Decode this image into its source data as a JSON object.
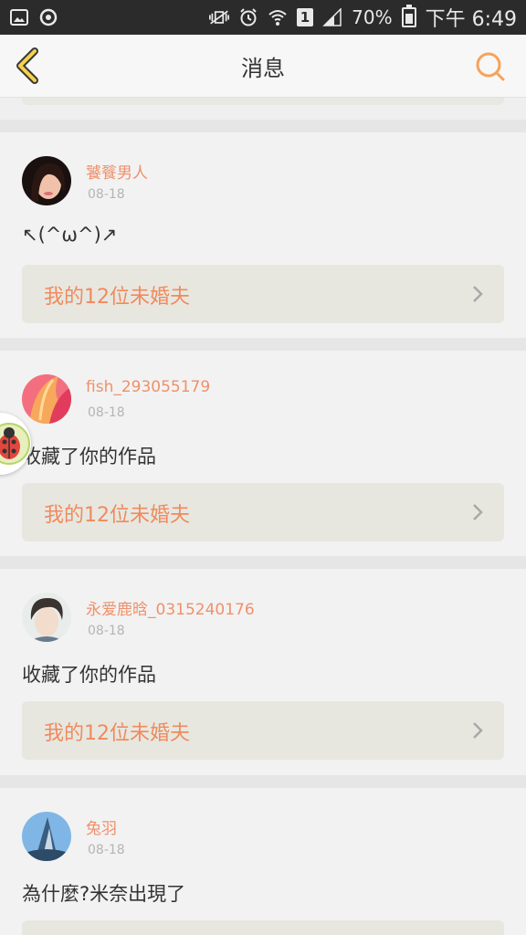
{
  "status_bar": {
    "battery": "70%",
    "time": "下午 6:49",
    "sim": "1",
    "icons": [
      "image-icon",
      "eye-icon",
      "mute-vibrate-icon",
      "alarm-icon",
      "wifi-icon",
      "signal-icon",
      "battery-icon"
    ]
  },
  "header": {
    "title": "消息",
    "back_icon": "chevron-left-icon",
    "search_icon": "search-icon",
    "accent": "#f5a35c"
  },
  "messages": [
    {
      "user": "饕餮男人",
      "date": "08-18",
      "text": "↖(^ω^)↗",
      "work": "我的12位未婚夫"
    },
    {
      "user": "fish_293055179",
      "date": "08-18",
      "text": "收藏了你的作品",
      "work": "我的12位未婚夫"
    },
    {
      "user": "永爱鹿晗_0315240176",
      "date": "08-18",
      "text": "收藏了你的作品",
      "work": "我的12位未婚夫"
    },
    {
      "user": "兔羽",
      "date": "08-18",
      "text": "為什麼?米奈出現了",
      "work": ""
    }
  ],
  "colors": {
    "name": "#f0906a",
    "work_title": "#f08a5d",
    "link_bg": "#e7e7e0",
    "status_bar": "#2b2b2b"
  }
}
